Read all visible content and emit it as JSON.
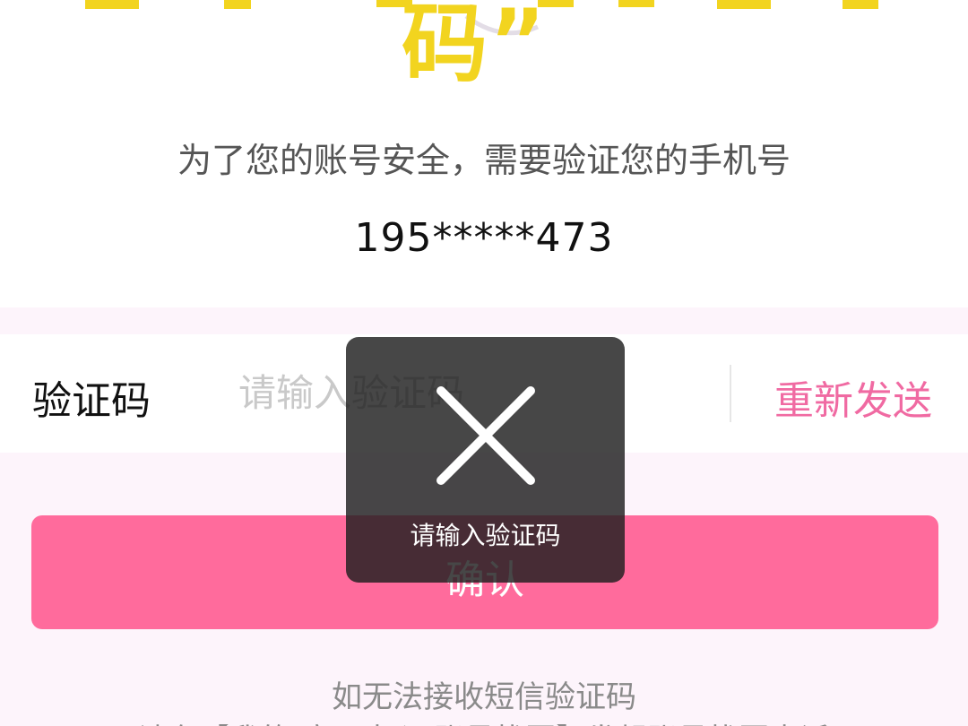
{
  "header": {
    "pixel_title_visible": "码”"
  },
  "verify": {
    "subtitle": "为了您的账号安全，需要验证您的手机号",
    "phone_masked": "195*****473"
  },
  "code_field": {
    "label": "验证码",
    "placeholder": "请输入验证码",
    "value": "",
    "resend_label": "重新发送"
  },
  "confirm": {
    "label": "确认"
  },
  "help": {
    "line1": "如无法接收短信验证码",
    "line2": "请在【我的-应用中心-账号找回】发起账号找回申诉"
  },
  "toast": {
    "icon": "close-icon",
    "message": "请输入验证码"
  },
  "colors": {
    "accent": "#ff6b9c",
    "resend": "#f06aa2",
    "pixel_title": "#f2d41f",
    "page_bg": "#fdf4fb"
  }
}
